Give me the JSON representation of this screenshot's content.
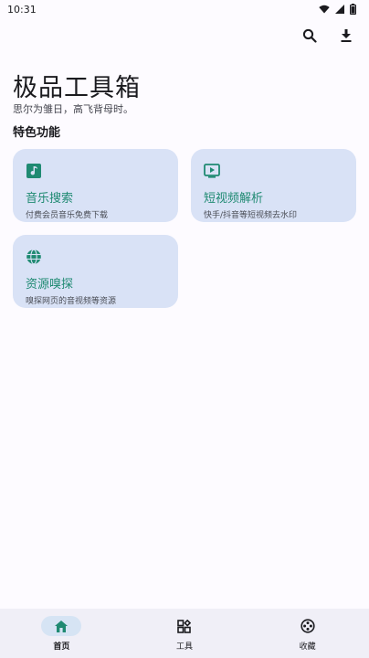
{
  "status_bar": {
    "time": "10:31",
    "icons": [
      "wifi-icon",
      "signal-icon",
      "battery-icon"
    ]
  },
  "top_actions": {
    "icons": [
      "search-icon",
      "download-icon"
    ]
  },
  "header": {
    "title": "极品工具箱",
    "subtitle": "思尔为雏日，高飞背母时。"
  },
  "section": {
    "title": "特色功能"
  },
  "cards": [
    {
      "icon": "music-note-icon",
      "title": "音乐搜索",
      "desc": "付费会员音乐免费下载"
    },
    {
      "icon": "video-play-icon",
      "title": "短视频解析",
      "desc": "快手/抖音等短视频去水印"
    },
    {
      "icon": "globe-icon",
      "title": "资源嗅探",
      "desc": "嗅探网页的音视频等资源"
    }
  ],
  "bottom_nav": {
    "items": [
      {
        "label": "首页",
        "icon": "home-icon",
        "active": true
      },
      {
        "label": "工具",
        "icon": "apps-icon",
        "active": false
      },
      {
        "label": "收藏",
        "icon": "film-reel-icon",
        "active": false
      }
    ]
  },
  "colors": {
    "accent": "#1f8a72",
    "card_bg": "#d9e2f6",
    "nav_bg": "#f0eff7"
  }
}
